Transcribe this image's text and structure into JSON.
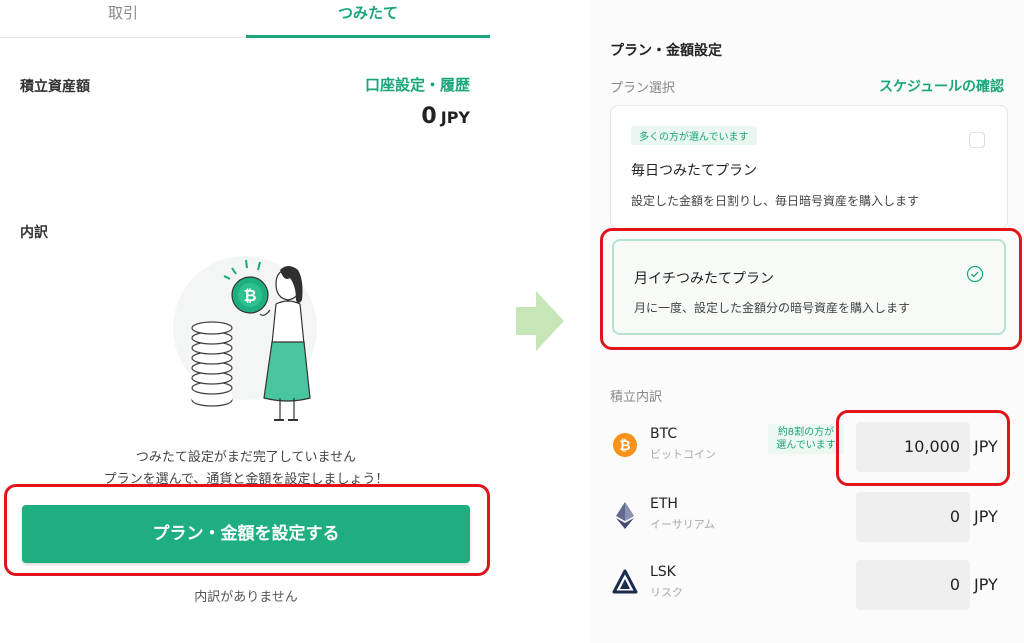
{
  "left": {
    "tabs": {
      "trade": "取引",
      "tsumitate": "つみたて"
    },
    "asset_label": "積立資産額",
    "account_link": "口座設定・履歴",
    "asset_value": "0",
    "asset_unit": "JPY",
    "breakdown_label": "内訳",
    "empty_line1": "つみたて設定がまだ完了していません",
    "empty_line2": "プランを選んで、通貨と金額を設定しましょう！",
    "cta_label": "プラン・金額を設定する",
    "no_breakdown": "内訳がありません"
  },
  "right": {
    "title": "プラン・金額設定",
    "plan_select_label": "プラン選択",
    "schedule_link": "スケジュールの確認",
    "plans": [
      {
        "badge": "多くの方が選んでいます",
        "name": "毎日つみたてプラン",
        "desc": "設定した金額を日割りし、毎日暗号資産を購入します",
        "selected": false
      },
      {
        "name": "月イチつみたてプラン",
        "desc": "月に一度、設定した金額分の暗号資産を購入します",
        "selected": true
      }
    ],
    "breakdown_label": "積立内訳",
    "coins": [
      {
        "symbol": "BTC",
        "name": "ビットコイン",
        "amount": "10,000",
        "unit": "JPY",
        "tag_line1": "約8割の方が",
        "tag_line2": "選んでいます",
        "icon": "bitcoin-icon"
      },
      {
        "symbol": "ETH",
        "name": "イーサリアム",
        "amount": "0",
        "unit": "JPY",
        "icon": "ethereum-icon"
      },
      {
        "symbol": "LSK",
        "name": "リスク",
        "amount": "0",
        "unit": "JPY",
        "icon": "lisk-icon"
      }
    ]
  },
  "colors": {
    "accent": "#1aa67a",
    "button": "#1fae80",
    "highlight": "#e0151c",
    "arrow": "#c6e6b8"
  }
}
